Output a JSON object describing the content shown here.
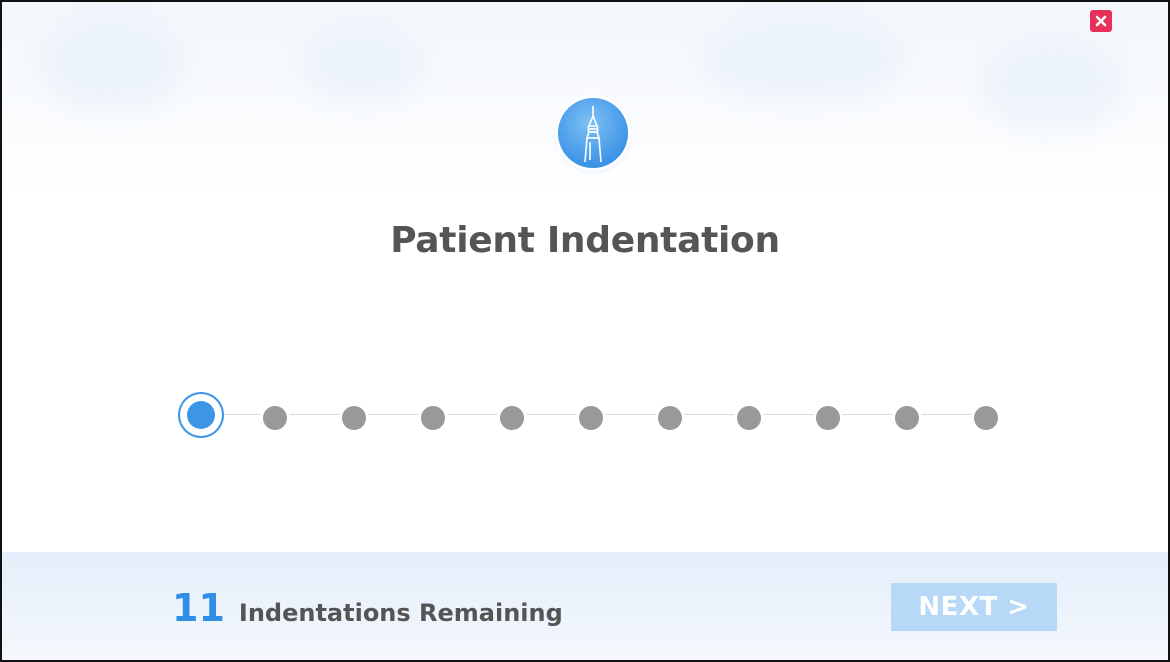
{
  "dialog": {
    "title": "Patient Indentation",
    "header_icon": "needle-icon",
    "close_icon": "close-icon",
    "colors": {
      "accent": "#3d95e6",
      "inactive_step": "#999999",
      "close": "#e8305a",
      "next_button": "#b7d8f7",
      "title_text": "#555555"
    }
  },
  "stepper": {
    "total": 11,
    "current": 1
  },
  "footer": {
    "remaining_count": "11",
    "remaining_label": "Indentations Remaining",
    "next_label": "NEXT >"
  }
}
